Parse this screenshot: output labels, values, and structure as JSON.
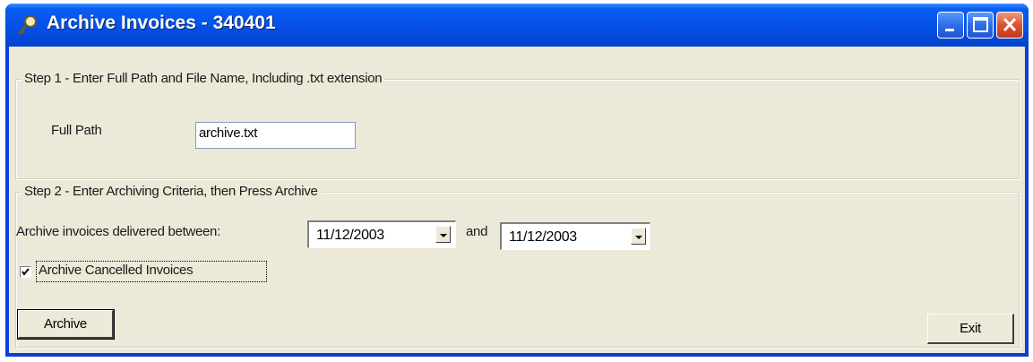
{
  "window": {
    "title": "Archive Invoices - 340401",
    "icon": "magnifier-key-icon"
  },
  "titlebar_buttons": {
    "minimize": "minimize-icon",
    "maximize": "maximize-icon",
    "close": "close-icon"
  },
  "step1": {
    "legend": "Step 1 - Enter Full Path and File Name, Including .txt extension",
    "full_path_label": "Full Path",
    "full_path_value": "archive.txt"
  },
  "step2": {
    "legend": "Step 2 - Enter Archiving Criteria, then Press Archive",
    "between_label": "Archive invoices delivered between:",
    "from_date": "11/12/2003",
    "and_label": "and",
    "to_date": "11/12/2003",
    "cancelled_label": "Archive Cancelled Invoices",
    "cancelled_checked": true
  },
  "buttons": {
    "archive": "Archive",
    "exit": "Exit"
  }
}
